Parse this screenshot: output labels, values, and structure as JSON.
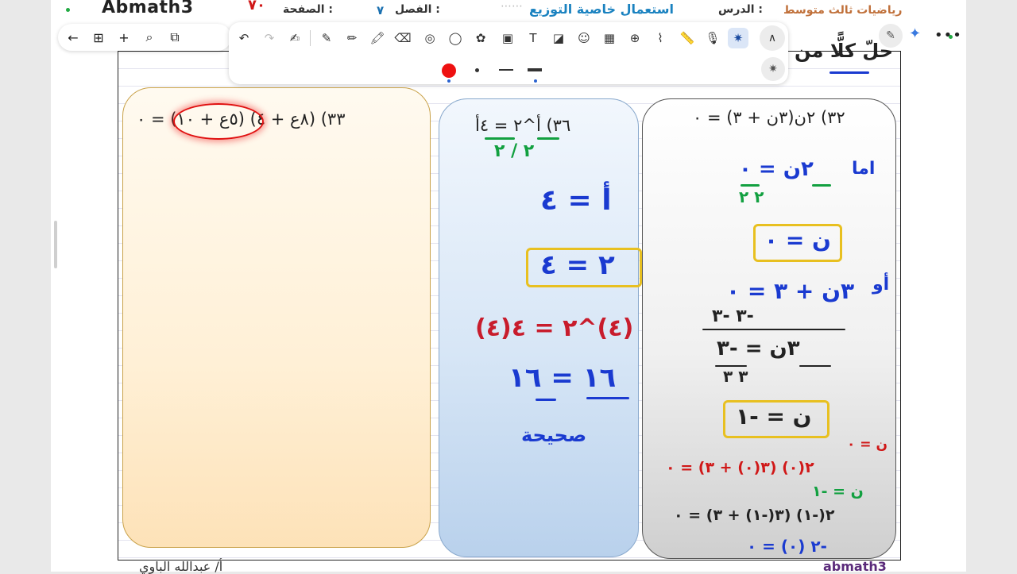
{
  "header": {
    "brand": "Abmath3",
    "page_number": "٧٠",
    "page_label": "الصفحة :",
    "chapter_number": "٧",
    "chapter_label": "الفصل :",
    "lesson_title": "استعمال خاصية التوزيع",
    "lesson_label": "الدرس :",
    "subject": "رياضيات ثالث متوسط"
  },
  "footer": {
    "teacher": "أ/ عبدالله الباوي",
    "site": "abmath3"
  },
  "nav": {
    "back_icon": "←",
    "grid_icon": "⊞",
    "add_icon": "+",
    "search_icon": "⌕",
    "pages_icon": "⧉"
  },
  "toolbar": {
    "undo": "↶",
    "redo": "↷",
    "lasso": "✍",
    "pen": "✎",
    "pencil": "✏",
    "highlighter": "🖍",
    "eraser": "⌫",
    "shape": "◎",
    "lasso_select": "◯",
    "sticker": "✿",
    "image": "▣",
    "text": "T",
    "note": "◪",
    "emoji": "☺",
    "table": "▦",
    "zoom": "⊕",
    "chart": "⌇",
    "ruler": "📏",
    "mic": "🎙",
    "laser": "✷",
    "collapse": "∧",
    "laser_small": "✷"
  },
  "right_tools": {
    "magic": "✎",
    "sparkle": "✦",
    "more": "•••"
  },
  "instruction": "حلّ كلًّا من",
  "questions": {
    "q33": "٣٣) (٨ع + ٤) (٥ع + ١٠) = ٠",
    "q36": "٣٦) أ^٢ = ٤أ",
    "q32": "٣٢) ٢ن(٣ن + ٣) = ٠"
  },
  "work_mid": {
    "line1": "٢/ = ٤",
    "line1_top": "أ = ٤",
    "line2_frac": "٢ / ٢",
    "line3": "٢ = ٤",
    "boxed": "٢ = ٤",
    "check": "(٤)^٢ = ٤(٤)",
    "eq16": "١٦ = ١٦",
    "correct": "صحيحة"
  },
  "work_right": {
    "either": "اما",
    "eq1": "٢ن = ٠",
    "frac1": "٢      ٢",
    "boxed1": "ن = ٠",
    "or": "أو",
    "eq2": "٣ن + ٣ = ٠",
    "sub": "-٣    -٣",
    "eq3": "٣ن = -٣",
    "frac2": "٣       ٣",
    "boxed2": "ن = -١",
    "check_n0": "ن = ٠",
    "check1": "٢(٠) (٣(٠) + ٣) = ٠",
    "check_n1": "ن = -١",
    "check2": "٢(-١) (٣(-١) + ٣) = ٠",
    "check3": "-٢ (٠) = ٠"
  }
}
